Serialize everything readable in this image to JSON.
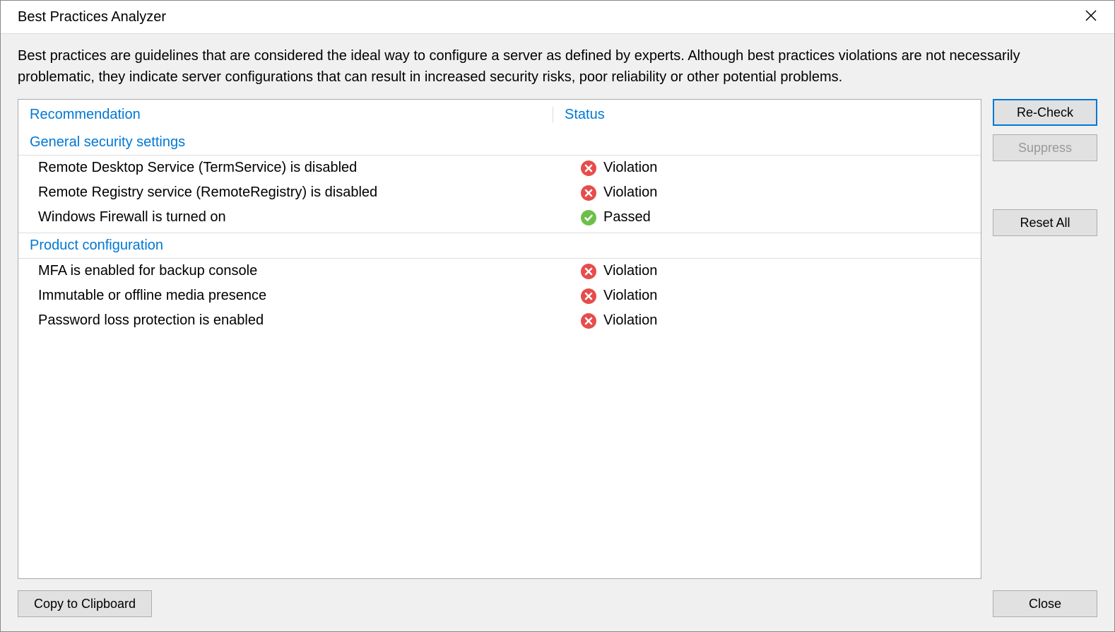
{
  "window": {
    "title": "Best Practices Analyzer"
  },
  "description": "Best practices are guidelines that are considered the ideal way to configure a server as defined by experts. Although best practices violations are not necessarily problematic, they indicate server configurations that can result in increased security risks, poor reliability or other potential problems.",
  "columns": {
    "recommendation": "Recommendation",
    "status": "Status"
  },
  "groups": [
    {
      "name": "General security settings",
      "items": [
        {
          "rec": "Remote Desktop Service (TermService) is disabled",
          "status": "Violation",
          "kind": "violation"
        },
        {
          "rec": "Remote Registry service (RemoteRegistry) is disabled",
          "status": "Violation",
          "kind": "violation"
        },
        {
          "rec": "Windows Firewall is turned on",
          "status": "Passed",
          "kind": "passed"
        }
      ]
    },
    {
      "name": "Product configuration",
      "items": [
        {
          "rec": "MFA is enabled for backup console",
          "status": "Violation",
          "kind": "violation"
        },
        {
          "rec": "Immutable or offline media presence",
          "status": "Violation",
          "kind": "violation"
        },
        {
          "rec": "Password loss protection is enabled",
          "status": "Violation",
          "kind": "violation"
        }
      ]
    }
  ],
  "buttons": {
    "recheck": "Re-Check",
    "suppress": "Suppress",
    "resetAll": "Reset All",
    "copy": "Copy to Clipboard",
    "close": "Close"
  }
}
